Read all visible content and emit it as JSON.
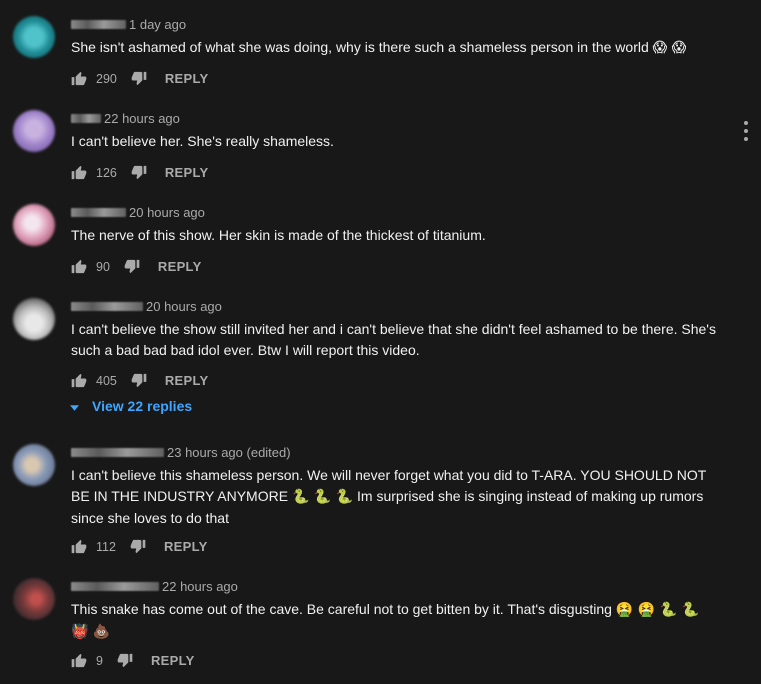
{
  "comments": [
    {
      "time": "1 day ago",
      "text": "She isn't ashamed of what she was doing, why is there such a shameless person in the world",
      "emojis": "😱 😱",
      "likes": "290",
      "reply_label": "REPLY"
    },
    {
      "time": "22 hours ago",
      "text": "I can't believe her. She's really shameless.",
      "likes": "126",
      "reply_label": "REPLY"
    },
    {
      "time": "20 hours ago",
      "text": "The nerve of this show.  Her skin is made of the thickest of titanium.",
      "likes": "90",
      "reply_label": "REPLY"
    },
    {
      "time": "20 hours ago",
      "text": "I can't believe the show still invited her and i can't believe that she didn't feel ashamed to be there. She's such a bad bad bad idol ever. Btw I will report this video.",
      "likes": "405",
      "reply_label": "REPLY",
      "view_replies": "View 22 replies"
    },
    {
      "time": "23 hours ago (edited)",
      "text_before": "I can't believe this shameless person. We will never forget what you did to T-ARA. YOU SHOULD NOT BE IN THE INDUSTRY ANYMORE",
      "emojis": "🐍 🐍 🐍",
      "text_after": "Im surprised she is singing instead of making up rumors since she loves to do that",
      "likes": "112",
      "reply_label": "REPLY"
    },
    {
      "time": "22 hours ago",
      "text": "This snake has come out of the cave.  Be careful not to get bitten by it. That's disgusting",
      "emojis": "🤮 🤮 🐍 🐍",
      "emojis_line2": "👹 💩",
      "likes": "9",
      "reply_label": "REPLY"
    }
  ],
  "icons": {
    "like": "thumb-up-icon",
    "dislike": "thumb-down-icon",
    "expand": "caret-down-icon",
    "more": "more-vert-icon"
  },
  "colors": {
    "background": "#181818",
    "text": "#f1f1f1",
    "secondary": "#aaaaaa",
    "link": "#3ea6ff"
  }
}
